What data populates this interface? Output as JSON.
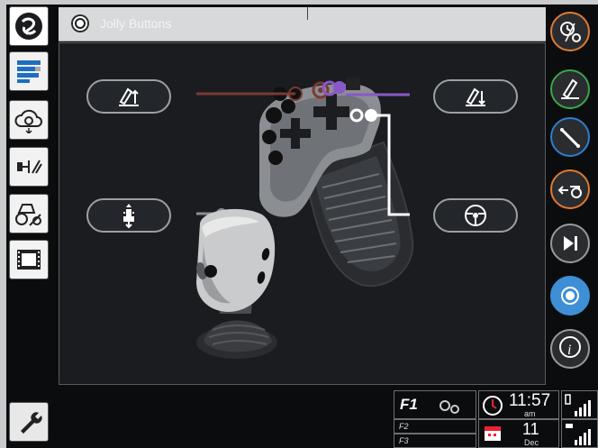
{
  "title": "Jolly Buttons",
  "left_nav": {
    "items": [
      {
        "name": "logo-icon"
      },
      {
        "name": "bars-icon"
      },
      {
        "name": "cloud-sync-icon"
      },
      {
        "name": "axle-icon"
      },
      {
        "name": "tractor-wrench-icon"
      },
      {
        "name": "film-icon"
      },
      {
        "name": "wrench-icon"
      }
    ]
  },
  "right_nav": {
    "items": [
      {
        "name": "clock-gear-icon",
        "ring": "#e07a2e"
      },
      {
        "name": "pen-up-icon",
        "ring": "#3aa64a"
      },
      {
        "name": "hydraulic-icon",
        "ring": "#2d7fd0"
      },
      {
        "name": "implement-icon",
        "ring": "#e07a2e"
      },
      {
        "name": "play-next-icon",
        "ring": "#9a9a9a"
      },
      {
        "name": "radio-icon",
        "ring": "#3f8fd6"
      },
      {
        "name": "info-icon",
        "ring": "#9a9a9a"
      }
    ]
  },
  "buttons": {
    "left_top_icon": "pen-up-icon",
    "left_bottom_icon": "implement-lift-icon",
    "right_top_icon": "pen-down-icon",
    "right_bottom_icon": "steering-wheel-icon"
  },
  "status": {
    "f1": "F1",
    "f2": "F2",
    "f3": "F3",
    "time": "11:57",
    "ampm": "am",
    "day": "11",
    "month": "Dec"
  },
  "colors": {
    "accent_blue": "#3f8fd6",
    "brown_line": "#7a3a34",
    "purple_line": "#8a58c8",
    "white_line": "#ffffff"
  }
}
